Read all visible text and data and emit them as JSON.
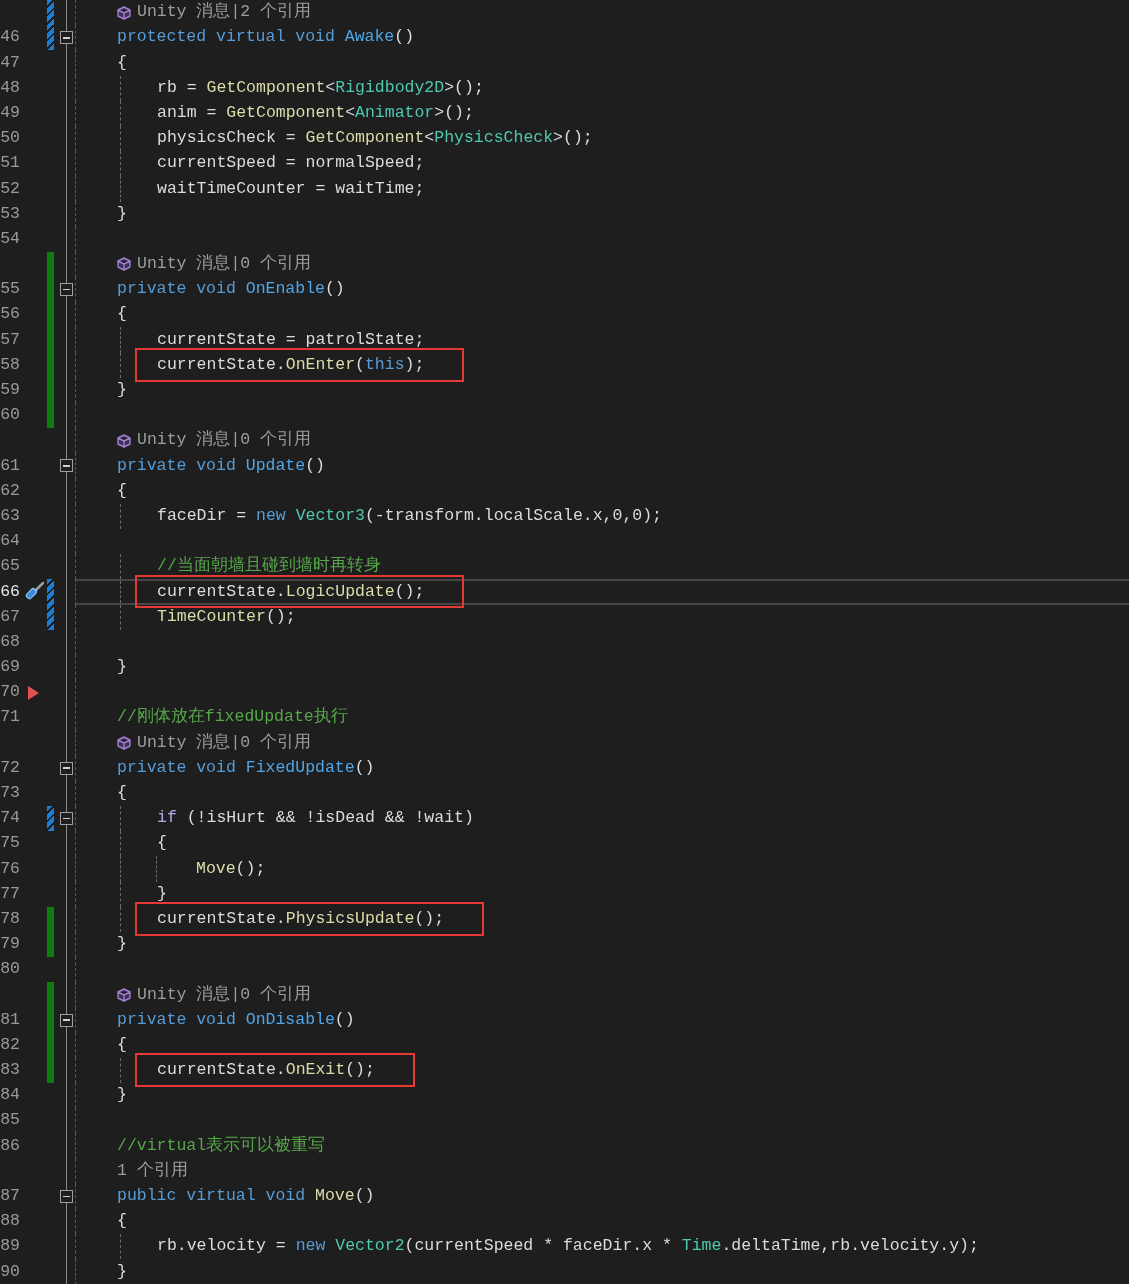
{
  "rows": [
    {
      "kind": "lens",
      "unity": true,
      "text": "Unity 消息|2 个引用",
      "change": {
        "kind": "reverted"
      }
    },
    {
      "kind": "code",
      "number": "46",
      "fold": true,
      "change": {
        "kind": "reverted"
      },
      "segments": [
        {
          "kind": "kw",
          "s": "protected virtual void "
        },
        {
          "kind": "kfn",
          "s": "Awake"
        },
        {
          "kind": "id",
          "s": "()"
        }
      ]
    },
    {
      "kind": "code",
      "number": "47",
      "segments": [
        {
          "kind": "id",
          "s": "{"
        }
      ]
    },
    {
      "kind": "code",
      "number": "48",
      "segments": [
        {
          "kind": "id",
          "s": "    rb = "
        },
        {
          "kind": "fn",
          "s": "GetComponent"
        },
        {
          "kind": "id",
          "s": "<"
        },
        {
          "kind": "type",
          "s": "Rigidbody2D"
        },
        {
          "kind": "id",
          "s": ">();"
        }
      ]
    },
    {
      "kind": "code",
      "number": "49",
      "segments": [
        {
          "kind": "id",
          "s": "    anim = "
        },
        {
          "kind": "fn",
          "s": "GetComponent"
        },
        {
          "kind": "id",
          "s": "<"
        },
        {
          "kind": "type",
          "s": "Animator"
        },
        {
          "kind": "id",
          "s": ">();"
        }
      ]
    },
    {
      "kind": "code",
      "number": "50",
      "segments": [
        {
          "kind": "id",
          "s": "    physicsCheck = "
        },
        {
          "kind": "fn",
          "s": "GetComponent"
        },
        {
          "kind": "id",
          "s": "<"
        },
        {
          "kind": "type",
          "s": "PhysicsCheck"
        },
        {
          "kind": "id",
          "s": ">();"
        }
      ]
    },
    {
      "kind": "code",
      "number": "51",
      "segments": [
        {
          "kind": "id",
          "s": "    currentSpeed = normalSpeed;"
        }
      ]
    },
    {
      "kind": "code",
      "number": "52",
      "segments": [
        {
          "kind": "id",
          "s": "    waitTimeCounter = waitTime;"
        }
      ]
    },
    {
      "kind": "code",
      "number": "53",
      "segments": [
        {
          "kind": "id",
          "s": "}"
        }
      ]
    },
    {
      "kind": "code",
      "number": "54"
    },
    {
      "kind": "lens",
      "unity": true,
      "text": "Unity 消息|0 个引用",
      "change": {
        "kind": "saved"
      }
    },
    {
      "kind": "code",
      "number": "55",
      "fold": true,
      "change": {
        "kind": "saved"
      },
      "segments": [
        {
          "kind": "kw",
          "s": "private void "
        },
        {
          "kind": "kfn",
          "s": "OnEnable"
        },
        {
          "kind": "id",
          "s": "()"
        }
      ]
    },
    {
      "kind": "code",
      "number": "56",
      "change": {
        "kind": "saved"
      },
      "segments": [
        {
          "kind": "id",
          "s": "{"
        }
      ]
    },
    {
      "kind": "code",
      "number": "57",
      "change": {
        "kind": "saved"
      },
      "segments": [
        {
          "kind": "id",
          "s": "    currentState = patrolState;"
        }
      ]
    },
    {
      "kind": "code",
      "number": "58",
      "change": {
        "kind": "saved"
      },
      "boxed": true,
      "segments": [
        {
          "kind": "id",
          "s": "    currentState."
        },
        {
          "kind": "fn",
          "s": "OnEnter"
        },
        {
          "kind": "id",
          "s": "("
        },
        {
          "kind": "kw",
          "s": "this"
        },
        {
          "kind": "id",
          "s": ");"
        }
      ]
    },
    {
      "kind": "code",
      "number": "59",
      "change": {
        "kind": "saved"
      },
      "segments": [
        {
          "kind": "id",
          "s": "}"
        }
      ]
    },
    {
      "kind": "code",
      "number": "60",
      "change": {
        "kind": "saved"
      }
    },
    {
      "kind": "lens",
      "unity": true,
      "text": "Unity 消息|0 个引用"
    },
    {
      "kind": "code",
      "number": "61",
      "fold": true,
      "segments": [
        {
          "kind": "kw",
          "s": "private void "
        },
        {
          "kind": "kfn",
          "s": "Update"
        },
        {
          "kind": "id",
          "s": "()"
        }
      ]
    },
    {
      "kind": "code",
      "number": "62",
      "segments": [
        {
          "kind": "id",
          "s": "{"
        }
      ]
    },
    {
      "kind": "code",
      "number": "63",
      "segments": [
        {
          "kind": "id",
          "s": "    faceDir = "
        },
        {
          "kind": "kw",
          "s": "new "
        },
        {
          "kind": "type",
          "s": "Vector3"
        },
        {
          "kind": "id",
          "s": "(-transform.localScale.x,0,0);"
        }
      ]
    },
    {
      "kind": "code",
      "number": "64"
    },
    {
      "kind": "code",
      "number": "65",
      "segments": [
        {
          "kind": "cm",
          "s": "    //当面朝墙且碰到墙时再转身"
        }
      ]
    },
    {
      "kind": "code",
      "number": "66",
      "current": true,
      "glyph": {
        "kind": "screwdriver"
      },
      "change": {
        "kind": "reverted"
      },
      "boxed": true,
      "segments": [
        {
          "kind": "id",
          "s": "    currentState."
        },
        {
          "kind": "fn",
          "s": "LogicUpdate"
        },
        {
          "kind": "id",
          "s": "();"
        }
      ]
    },
    {
      "kind": "code",
      "number": "67",
      "change": {
        "kind": "reverted"
      },
      "segments": [
        {
          "kind": "fn",
          "s": "    TimeCounter"
        },
        {
          "kind": "id",
          "s": "();"
        }
      ]
    },
    {
      "kind": "code",
      "number": "68"
    },
    {
      "kind": "code",
      "number": "69",
      "segments": [
        {
          "kind": "id",
          "s": "}"
        }
      ]
    },
    {
      "kind": "code",
      "number": "70",
      "glyph": {
        "kind": "triangle"
      }
    },
    {
      "kind": "code",
      "number": "71",
      "segments": [
        {
          "kind": "cm",
          "s": "//刚体放在fixedUpdate执行"
        }
      ]
    },
    {
      "kind": "lens",
      "unity": true,
      "text": "Unity 消息|0 个引用"
    },
    {
      "kind": "code",
      "number": "72",
      "fold": true,
      "segments": [
        {
          "kind": "kw",
          "s": "private void "
        },
        {
          "kind": "kfn",
          "s": "FixedUpdate"
        },
        {
          "kind": "id",
          "s": "()"
        }
      ]
    },
    {
      "kind": "code",
      "number": "73",
      "segments": [
        {
          "kind": "id",
          "s": "{"
        }
      ]
    },
    {
      "kind": "code",
      "number": "74",
      "fold": true,
      "change": {
        "kind": "reverted"
      },
      "segments": [
        {
          "kind": "ctl",
          "s": "    if "
        },
        {
          "kind": "id",
          "s": "(!isHurt && !isDead && !wait)"
        }
      ]
    },
    {
      "kind": "code",
      "number": "75",
      "segments": [
        {
          "kind": "id",
          "s": "    {"
        }
      ]
    },
    {
      "kind": "code",
      "number": "76",
      "segments": [
        {
          "kind": "fn",
          "s": "        Move"
        },
        {
          "kind": "id",
          "s": "();"
        }
      ]
    },
    {
      "kind": "code",
      "number": "77",
      "segments": [
        {
          "kind": "id",
          "s": "    }"
        }
      ]
    },
    {
      "kind": "code",
      "number": "78",
      "change": {
        "kind": "saved"
      },
      "boxed": true,
      "segments": [
        {
          "kind": "id",
          "s": "    currentState."
        },
        {
          "kind": "fn",
          "s": "PhysicsUpdate"
        },
        {
          "kind": "id",
          "s": "();"
        }
      ]
    },
    {
      "kind": "code",
      "number": "79",
      "change": {
        "kind": "saved"
      },
      "segments": [
        {
          "kind": "id",
          "s": "}"
        }
      ]
    },
    {
      "kind": "code",
      "number": "80"
    },
    {
      "kind": "lens",
      "unity": true,
      "text": "Unity 消息|0 个引用",
      "change": {
        "kind": "saved"
      }
    },
    {
      "kind": "code",
      "number": "81",
      "fold": true,
      "change": {
        "kind": "saved"
      },
      "segments": [
        {
          "kind": "kw",
          "s": "private void "
        },
        {
          "kind": "kfn",
          "s": "OnDisable"
        },
        {
          "kind": "id",
          "s": "()"
        }
      ]
    },
    {
      "kind": "code",
      "number": "82",
      "change": {
        "kind": "saved"
      },
      "segments": [
        {
          "kind": "id",
          "s": "{"
        }
      ]
    },
    {
      "kind": "code",
      "number": "83",
      "change": {
        "kind": "saved"
      },
      "boxed": true,
      "segments": [
        {
          "kind": "id",
          "s": "    currentState."
        },
        {
          "kind": "fn",
          "s": "OnExit"
        },
        {
          "kind": "id",
          "s": "();"
        }
      ]
    },
    {
      "kind": "code",
      "number": "84",
      "segments": [
        {
          "kind": "id",
          "s": "}"
        }
      ]
    },
    {
      "kind": "code",
      "number": "85"
    },
    {
      "kind": "code",
      "number": "86",
      "segments": [
        {
          "kind": "cm",
          "s": "//virtual表示可以被重写"
        }
      ]
    },
    {
      "kind": "lens",
      "unity": false,
      "text": "1 个引用"
    },
    {
      "kind": "code",
      "number": "87",
      "fold": true,
      "segments": [
        {
          "kind": "kw",
          "s": "public virtual void "
        },
        {
          "kind": "fn",
          "s": "Move"
        },
        {
          "kind": "id",
          "s": "()"
        }
      ]
    },
    {
      "kind": "code",
      "number": "88",
      "segments": [
        {
          "kind": "id",
          "s": "{"
        }
      ]
    },
    {
      "kind": "code",
      "number": "89",
      "segments": [
        {
          "kind": "id",
          "s": "    rb.velocity = "
        },
        {
          "kind": "kw",
          "s": "new "
        },
        {
          "kind": "type",
          "s": "Vector2"
        },
        {
          "kind": "id",
          "s": "(currentSpeed * faceDir.x * "
        },
        {
          "kind": "type",
          "s": "Time"
        },
        {
          "kind": "id",
          "s": ".deltaTime,rb.velocity.y);"
        }
      ]
    },
    {
      "kind": "code",
      "number": "90",
      "segments": [
        {
          "kind": "id",
          "s": "}"
        }
      ]
    }
  ]
}
